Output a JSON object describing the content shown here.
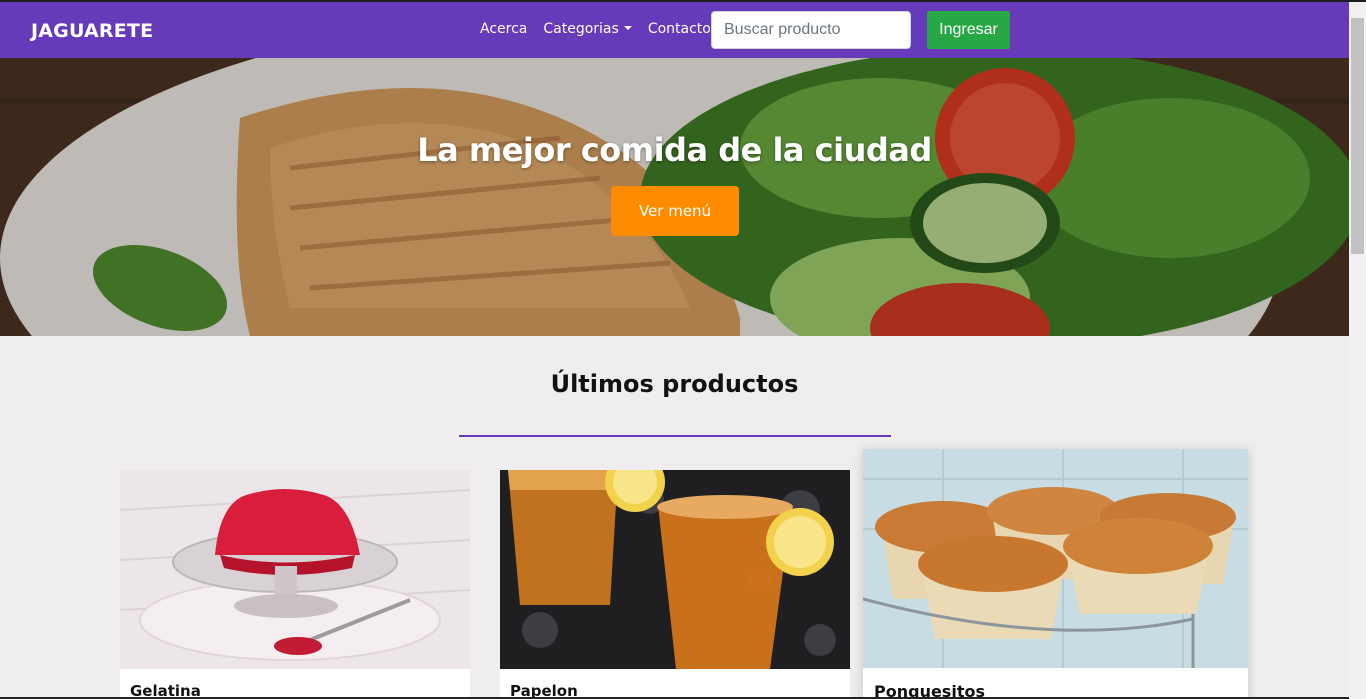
{
  "navbar": {
    "brand": "JAGUARETE",
    "links": [
      "Acerca",
      "Categorias",
      "Contacto"
    ],
    "search_placeholder": "Buscar producto",
    "login_label": "Ingresar",
    "background_color": "#663ab9"
  },
  "hero": {
    "title": "La mejor comida de la ciudad",
    "button_label": "Ver menú",
    "button_color": "#ff8c00"
  },
  "products_section": {
    "title": "Últimos productos",
    "products": [
      {
        "name": "Gelatina",
        "image": "red-gelatin-image"
      },
      {
        "name": "Papelon",
        "image": "papelon-drink-image"
      },
      {
        "name": "Ponquesitos",
        "image": "cupcakes-image"
      }
    ]
  }
}
